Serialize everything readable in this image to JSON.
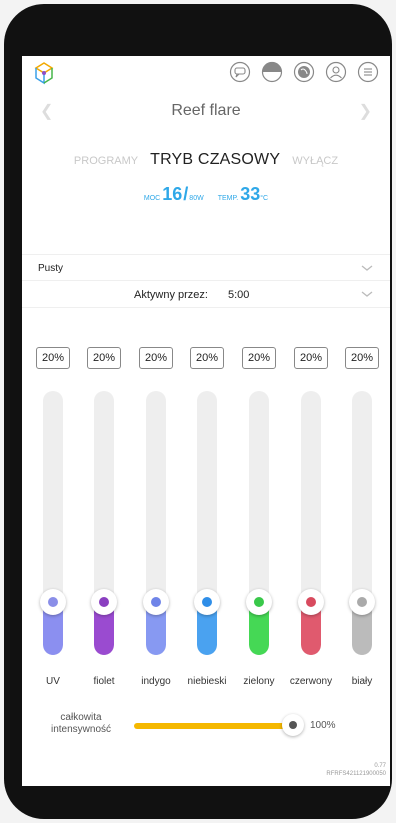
{
  "header": {
    "device_title": "Reef flare",
    "icons": [
      "logo-icon",
      "chat-icon",
      "half-moon-icon",
      "globe-icon",
      "user-icon",
      "menu-icon"
    ]
  },
  "modes": {
    "programs": "PROGRAMY",
    "timer": "TRYB CZASOWY",
    "off": "WYŁĄCZ"
  },
  "readout": {
    "power_label": "MOC",
    "power_value": "16",
    "power_max": "80W",
    "temp_label": "TEMP.",
    "temp_value": "33",
    "temp_unit": "°C"
  },
  "preset": {
    "label": "Pusty"
  },
  "active": {
    "label": "Aktywny przez:",
    "value": "5:00"
  },
  "channels": [
    {
      "name": "UV",
      "percent": "20%",
      "level": 0.2,
      "color": "#8a8ee8",
      "fill": "#8b8ff0"
    },
    {
      "name": "fiolet",
      "percent": "20%",
      "level": 0.2,
      "color": "#8a3fc0",
      "fill": "#9a4bd0"
    },
    {
      "name": "indygo",
      "percent": "20%",
      "level": 0.2,
      "color": "#6f84e8",
      "fill": "#8799f2"
    },
    {
      "name": "niebieski",
      "percent": "20%",
      "level": 0.2,
      "color": "#2f8ee8",
      "fill": "#4aa2f0"
    },
    {
      "name": "zielony",
      "percent": "20%",
      "level": 0.2,
      "color": "#39c84a",
      "fill": "#45d855"
    },
    {
      "name": "czerwony",
      "percent": "20%",
      "level": 0.2,
      "color": "#d84a5e",
      "fill": "#e05a6e"
    },
    {
      "name": "biały",
      "percent": "20%",
      "level": 0.2,
      "color": "#aaaaaa",
      "fill": "#bbbbbb"
    }
  ],
  "total": {
    "label": "całkowita intensywność",
    "value": "100%",
    "level": 1.0
  },
  "version": {
    "number": "0.77",
    "serial": "RFRFS421121900050"
  }
}
